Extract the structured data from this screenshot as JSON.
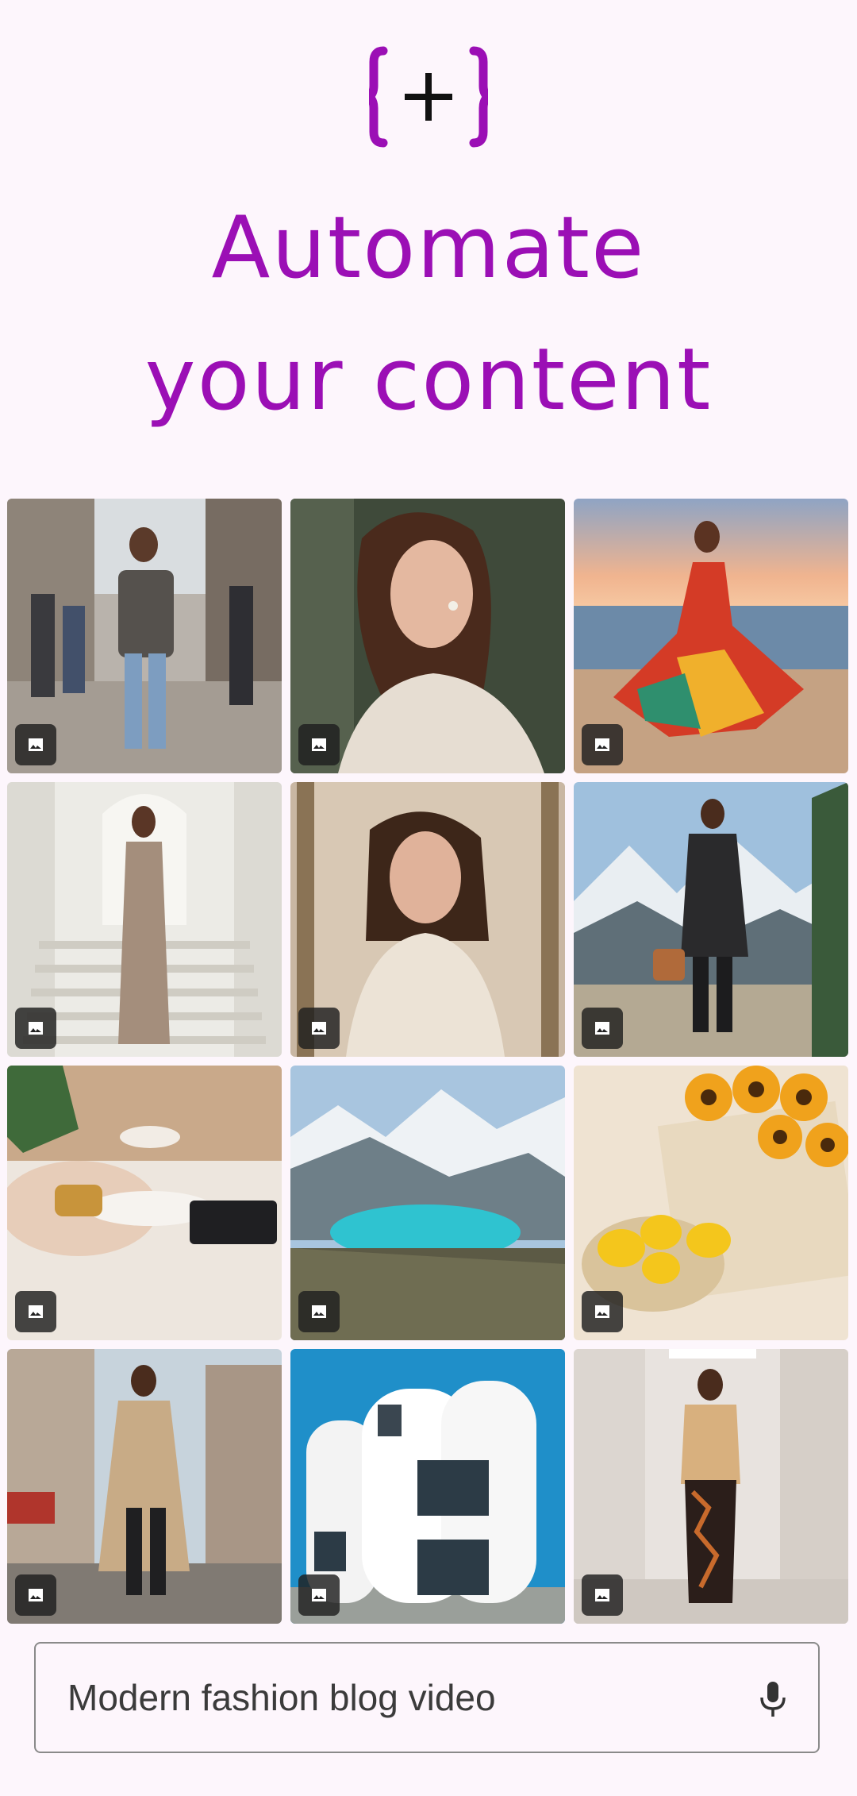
{
  "app": {
    "logo_icon": "bracket-plus-icon",
    "brand_color": "#9b0fb5",
    "headline_line1": "Automate",
    "headline_line2": "your content"
  },
  "gallery": {
    "badge_icon": "image-icon",
    "tiles": [
      {
        "subject": "street-style-city"
      },
      {
        "subject": "portrait-sweater"
      },
      {
        "subject": "beach-sunset-dress"
      },
      {
        "subject": "staircase-sequin-gown"
      },
      {
        "subject": "mirror-laughing"
      },
      {
        "subject": "mountains-coat"
      },
      {
        "subject": "coffee-table-bracelets"
      },
      {
        "subject": "turquoise-lake"
      },
      {
        "subject": "sunflowers-lemons"
      },
      {
        "subject": "old-town-trench"
      },
      {
        "subject": "white-building"
      },
      {
        "subject": "fitting-room-selfie"
      }
    ]
  },
  "search": {
    "value": "Modern fashion blog video",
    "mic_icon": "microphone-icon"
  }
}
